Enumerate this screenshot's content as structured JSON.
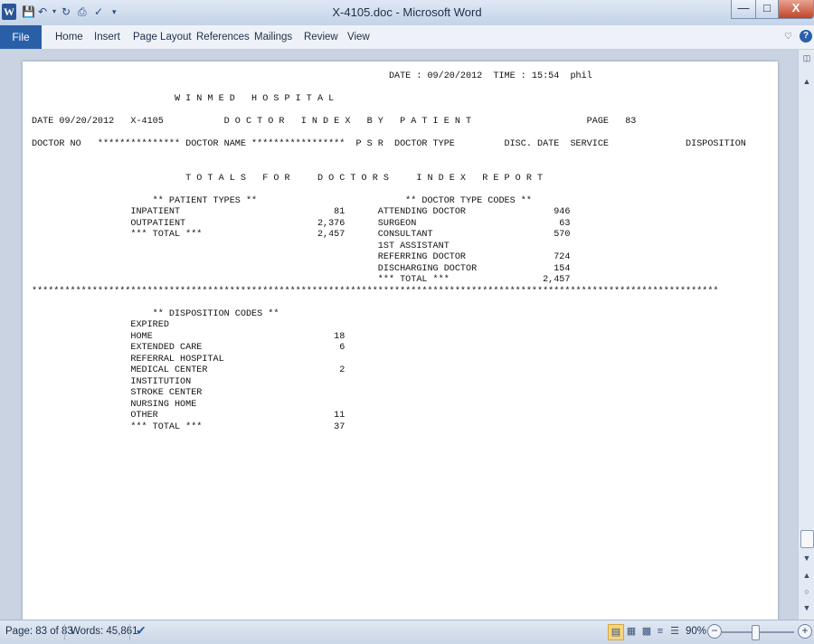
{
  "window": {
    "title": "X-4105.doc - Microsoft Word",
    "app_icon": "W",
    "minimize": "—",
    "maximize": "□",
    "close": "X"
  },
  "quick_access": [
    "save-icon",
    "undo-icon",
    "redo-icon",
    "print-icon",
    "spelling-icon",
    "customize-icon"
  ],
  "ribbon": {
    "file": "File",
    "tabs": [
      "Home",
      "Insert",
      "Page Layout",
      "References",
      "Mailings",
      "Review",
      "View"
    ]
  },
  "document": {
    "lines": [
      "                                                                 DATE : 09/20/2012  TIME : 15:54  phil",
      "",
      "                          W I N M E D   H O S P I T A L",
      "",
      "DATE 09/20/2012   X-4105           D O C T O R   I N D E X   B Y   P A T I E N T                     PAGE   83",
      "",
      "DOCTOR NO   *************** DOCTOR NAME *****************  P S R  DOCTOR TYPE         DISC. DATE  SERVICE              DISPOSITION",
      "",
      "",
      "                            T O T A L S   F O R     D O C T O R S     I N D E X   R E P O R T",
      "",
      "                      ** PATIENT TYPES **                           ** DOCTOR TYPE CODES **",
      "                  INPATIENT                            81      ATTENDING DOCTOR                946",
      "                  OUTPATIENT                        2,376      SURGEON                          63",
      "                  *** TOTAL ***                     2,457      CONSULTANT                      570",
      "                                                               1ST ASSISTANT",
      "                                                               REFERRING DOCTOR                724",
      "                                                               DISCHARGING DOCTOR              154",
      "                                                               *** TOTAL ***                 2,457",
      "*****************************************************************************************************************************",
      "",
      "                      ** DISPOSITION CODES **",
      "                  EXPIRED",
      "                  HOME                                 18",
      "                  EXTENDED CARE                         6",
      "                  REFERRAL HOSPITAL",
      "                  MEDICAL CENTER                        2",
      "                  INSTITUTION",
      "                  STROKE CENTER",
      "                  NURSING HOME",
      "                  OTHER                                11",
      "                  *** TOTAL ***                        37"
    ]
  },
  "status": {
    "page": "Page: 83 of 83",
    "words": "Words: 45,861",
    "zoom": "90%",
    "zoom_level": 0.9
  },
  "icons": {
    "proofing": "proofing-check-icon",
    "views": [
      "print-layout-icon",
      "full-screen-reading-icon",
      "web-layout-icon",
      "outline-icon",
      "draft-icon"
    ]
  }
}
